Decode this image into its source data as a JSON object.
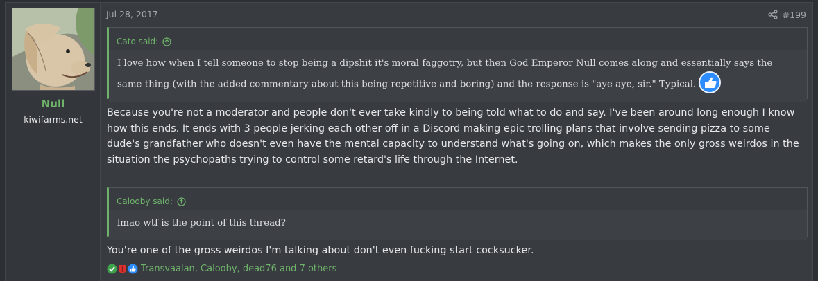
{
  "post": {
    "date": "Jul 28, 2017",
    "number": "#199"
  },
  "user": {
    "name": "Null",
    "title": "kiwifarms.net"
  },
  "quote1": {
    "author": "Cato said:",
    "text": "I love how when I tell someone to stop being a dipshit it's moral faggotry, but then God Emperor Null comes along and essentially says the same thing (with the added commentary about this being repetitive and boring) and the response is \"aye aye, sir.\" Typical."
  },
  "body1": "Because you're not a moderator and people don't ever take kindly to being told what to do and say. I've been around long enough I know how this ends. It ends with 3 people jerking each other off in a Discord making epic trolling plans that involve sending pizza to some dude's grandfather who doesn't even have the mental capacity to understand what's going on, which makes the only gross weirdos in the situation the psychopaths trying to control some retard's life through the Internet.",
  "quote2": {
    "author": "Calooby said:",
    "text": "lmao wtf is the point of this thread?"
  },
  "body2": "You're one of the gross weirdos I'm talking about don't even fucking start cocksucker.",
  "reactions": {
    "icons": [
      "check-icon",
      "winner-icon",
      "like-icon"
    ],
    "users": "Transvaalan, Calooby, dead76 and 7 others"
  },
  "colors": {
    "accent": "#6fb36a",
    "background": "#383c41",
    "like_blue": "#2d8cff"
  }
}
